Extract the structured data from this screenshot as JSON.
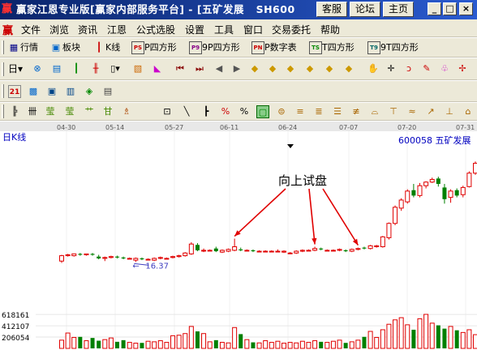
{
  "window": {
    "title": "赢家江恩专业版[赢家内部服务平台] - [五矿发展",
    "title_code": "SH600",
    "buttons": [
      "客服",
      "论坛",
      "主页"
    ]
  },
  "menu": [
    "文件",
    "浏览",
    "资讯",
    "江恩",
    "公式选股",
    "设置",
    "工具",
    "窗口",
    "交易委托",
    "帮助"
  ],
  "toolbar1": [
    "行情",
    "板块",
    "K线",
    "P四方形",
    "9P四方形",
    "P数字表",
    "T四方形",
    "9T四方形"
  ],
  "toolbar1_boxes": [
    "PS",
    "P9",
    "PN",
    "TS",
    "T9"
  ],
  "period_selector": "日",
  "chart_data": {
    "type": "candlestick",
    "title": "日K线",
    "stock": "600058 五矿发展",
    "dates": [
      "04-30",
      "05-14",
      "05-27",
      "06-11",
      "06-24",
      "07-07",
      "07-20",
      "07-31"
    ],
    "annotation": "向上试盘",
    "low_label": "16.37",
    "low_marker": "←",
    "volume_ticks": [
      "618161",
      "412107",
      "206054"
    ],
    "candles": [
      [
        14.7,
        15.4,
        14.5,
        15.3
      ],
      [
        15.3,
        15.5,
        15.2,
        15.4
      ],
      [
        15.3,
        15.5,
        15.2,
        15.5
      ],
      [
        15.5,
        15.6,
        15.3,
        15.4
      ],
      [
        15.4,
        15.5,
        15.3,
        15.5
      ],
      [
        15.5,
        15.6,
        15.3,
        15.4
      ],
      [
        15.2,
        15.4,
        14.9,
        15.0
      ],
      [
        15.0,
        15.2,
        14.7,
        15.1
      ],
      [
        15.1,
        15.3,
        15.0,
        15.2
      ],
      [
        15.2,
        15.3,
        15.0,
        15.1
      ],
      [
        15.1,
        15.2,
        14.9,
        15.0
      ],
      [
        15.0,
        15.1,
        14.9,
        15.0
      ],
      [
        14.8,
        15.1,
        14.6,
        15.0
      ],
      [
        15.0,
        15.1,
        14.8,
        14.9
      ],
      [
        14.9,
        15.0,
        14.8,
        14.9
      ],
      [
        14.8,
        15.1,
        14.7,
        15.0
      ],
      [
        15.0,
        15.2,
        14.9,
        15.1
      ],
      [
        15.0,
        15.1,
        14.9,
        15.0
      ],
      [
        15.1,
        15.3,
        15.0,
        15.2
      ],
      [
        15.2,
        15.4,
        15.1,
        15.3
      ],
      [
        15.3,
        15.7,
        15.2,
        15.6
      ],
      [
        15.5,
        16.8,
        15.4,
        16.6
      ],
      [
        16.5,
        16.7,
        15.8,
        15.9
      ],
      [
        15.9,
        16.1,
        15.7,
        15.9
      ],
      [
        15.9,
        16.0,
        15.8,
        15.9
      ],
      [
        16.1,
        16.3,
        15.7,
        15.8
      ],
      [
        15.7,
        16.0,
        15.6,
        15.9
      ],
      [
        15.8,
        16.1,
        15.7,
        16.0
      ],
      [
        15.9,
        17.2,
        15.8,
        16.3
      ],
      [
        16.0,
        16.2,
        15.8,
        15.9
      ],
      [
        15.9,
        16.0,
        15.8,
        15.9
      ],
      [
        15.9,
        16.0,
        15.7,
        15.8
      ],
      [
        15.8,
        15.9,
        15.7,
        15.8
      ],
      [
        15.8,
        15.9,
        15.7,
        15.8
      ],
      [
        15.8,
        15.9,
        15.7,
        15.8
      ],
      [
        15.8,
        16.0,
        15.7,
        15.8
      ],
      [
        15.7,
        15.9,
        15.6,
        15.8
      ],
      [
        15.6,
        15.7,
        15.5,
        15.6
      ],
      [
        15.6,
        15.9,
        15.5,
        15.8
      ],
      [
        15.8,
        16.0,
        15.7,
        15.9
      ],
      [
        15.9,
        16.0,
        15.8,
        15.9
      ],
      [
        15.9,
        16.3,
        15.8,
        16.1
      ],
      [
        16.1,
        16.2,
        15.9,
        16.0
      ],
      [
        15.9,
        16.0,
        15.8,
        15.9
      ],
      [
        15.9,
        16.0,
        15.8,
        15.9
      ],
      [
        15.9,
        16.1,
        15.8,
        16.0
      ],
      [
        15.9,
        16.0,
        15.7,
        15.8
      ],
      [
        15.8,
        16.1,
        15.7,
        16.0
      ],
      [
        16.0,
        16.2,
        15.9,
        16.1
      ],
      [
        16.2,
        16.3,
        16.0,
        16.1
      ],
      [
        16.1,
        16.5,
        16.0,
        16.4
      ],
      [
        16.3,
        16.5,
        16.2,
        16.4
      ],
      [
        16.3,
        17.5,
        16.2,
        17.4
      ],
      [
        17.3,
        19.0,
        17.1,
        18.9
      ],
      [
        18.9,
        20.9,
        18.7,
        20.7
      ],
      [
        20.6,
        21.7,
        20.3,
        21.5
      ],
      [
        21.3,
        22.7,
        21.1,
        22.5
      ],
      [
        22.6,
        23.3,
        21.8,
        22.0
      ],
      [
        22.0,
        23.4,
        21.8,
        23.1
      ],
      [
        23.1,
        23.6,
        22.8,
        23.5
      ],
      [
        23.5,
        24.0,
        23.4,
        23.8
      ],
      [
        23.9,
        24.1,
        23.0,
        23.3
      ],
      [
        22.9,
        23.3,
        21.1,
        21.6
      ],
      [
        21.8,
        22.7,
        21.2,
        22.5
      ],
      [
        22.6,
        22.8,
        21.8,
        22.0
      ],
      [
        22.1,
        23.1,
        21.8,
        22.9
      ],
      [
        23.0,
        24.7,
        22.9,
        24.5
      ],
      [
        24.5,
        25.8,
        24.3,
        25.6
      ]
    ],
    "volumes": [
      150000,
      280000,
      200000,
      210000,
      140000,
      190000,
      140000,
      160000,
      190000,
      120000,
      150000,
      110000,
      95000,
      100000,
      130000,
      120000,
      140000,
      110000,
      230000,
      240000,
      270000,
      400000,
      310000,
      270000,
      120000,
      150000,
      110000,
      100000,
      380000,
      260000,
      160000,
      110000,
      100000,
      140000,
      110000,
      130000,
      95000,
      110000,
      100000,
      130000,
      110000,
      140000,
      120000,
      110000,
      130000,
      150000,
      100000,
      120000,
      150000,
      210000,
      310000,
      200000,
      340000,
      440000,
      520000,
      560000,
      430000,
      340000,
      540000,
      620000,
      460000,
      420000,
      360000,
      400000,
      330000,
      290000,
      340000,
      250000
    ],
    "ylim": [
      14.0,
      27.0
    ],
    "vol_max": 650000
  }
}
